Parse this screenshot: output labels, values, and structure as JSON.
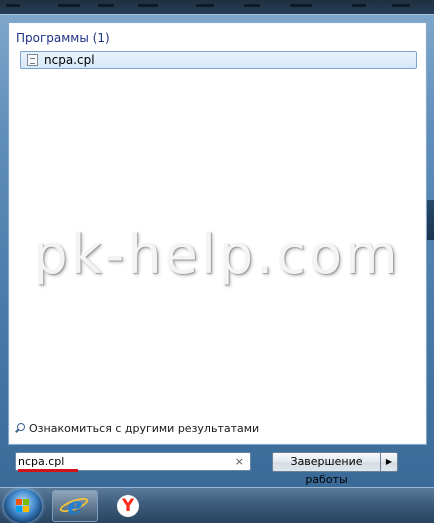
{
  "start_menu": {
    "section_header": "Программы (1)",
    "results": [
      {
        "label": "ncpa.cpl",
        "icon": "control-panel-file-icon"
      }
    ],
    "watermark": "pk-help.com",
    "see_more_label": "Ознакомиться с другими результатами",
    "search": {
      "value": "ncpa.cpl",
      "clear_glyph": "×"
    },
    "shutdown": {
      "label": "Завершение работы",
      "arrow_glyph": "▶"
    }
  },
  "taskbar": {
    "items": [
      {
        "name": "start-button",
        "icon": "windows-orb-icon"
      },
      {
        "name": "internet-explorer",
        "icon": "ie-icon",
        "glyph": "e"
      },
      {
        "name": "yandex-browser",
        "icon": "yandex-icon",
        "glyph": "Y"
      }
    ]
  },
  "colors": {
    "header_text": "#1e3287",
    "selection_border": "#7da2ce",
    "annotation_red": "#d0141a"
  }
}
